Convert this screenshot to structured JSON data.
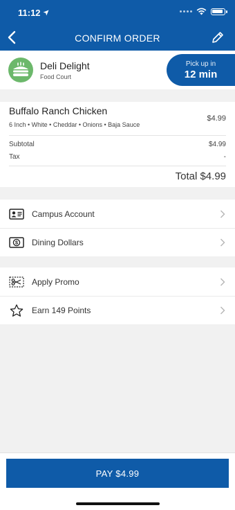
{
  "status_bar": {
    "time": "11:12"
  },
  "header": {
    "title": "CONFIRM ORDER"
  },
  "restaurant": {
    "name": "Deli Delight",
    "location": "Food Court",
    "pickup_label": "Pick up in",
    "pickup_time": "12 min"
  },
  "order": {
    "item_name": "Buffalo Ranch Chicken",
    "item_options": "6 Inch • White • Cheddar • Onions • Baja Sauce",
    "item_price": "$4.99",
    "subtotal_label": "Subtotal",
    "subtotal_value": "$4.99",
    "tax_label": "Tax",
    "tax_value": "-",
    "total": "Total $4.99"
  },
  "payment_methods": [
    {
      "label": "Campus Account",
      "icon": "id-card-icon"
    },
    {
      "label": "Dining Dollars",
      "icon": "dollar-bill-icon"
    }
  ],
  "extras": [
    {
      "label": "Apply Promo",
      "icon": "scissors-icon"
    },
    {
      "label": "Earn 149 Points",
      "icon": "star-icon"
    }
  ],
  "pay_button": {
    "label": "PAY $4.99"
  },
  "colors": {
    "brand": "#0f5ba8",
    "logo_green": "#6cb86b",
    "background": "#f1f1f1"
  }
}
